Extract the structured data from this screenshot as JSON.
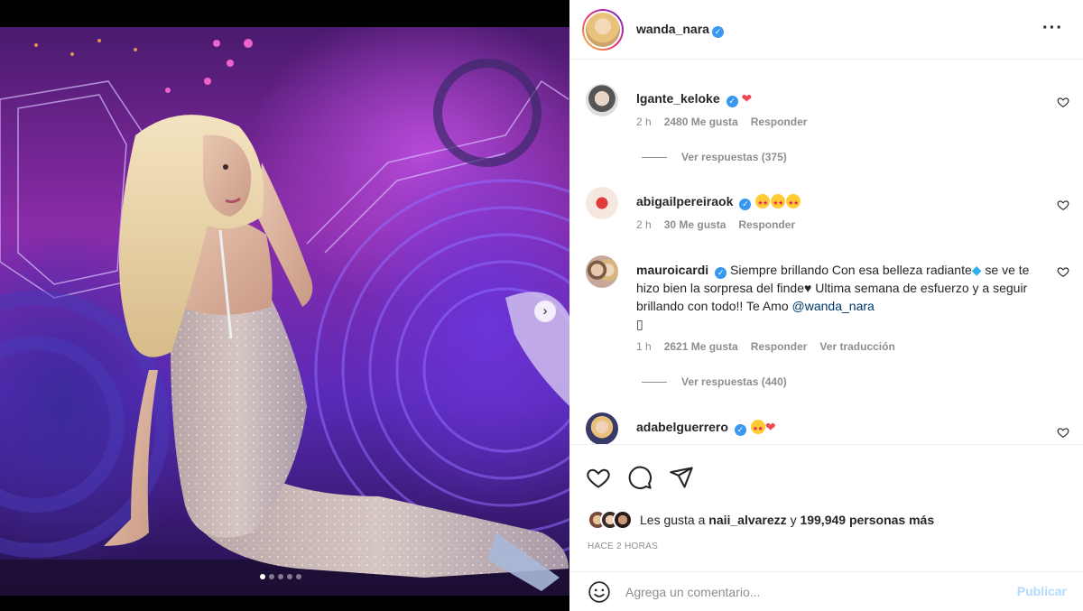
{
  "post": {
    "author": "wanda_nara",
    "more_icon": "more-options-icon",
    "carousel": {
      "slides": 5,
      "active": 1
    }
  },
  "comments": [
    {
      "user": "lgante_keloke",
      "verified": true,
      "text": "",
      "emoji": "heart",
      "time": "2 h",
      "likes": "2480 Me gusta",
      "reply": "Responder",
      "replies": "Ver respuestas (375)"
    },
    {
      "user": "abigailpereiraok",
      "verified": true,
      "text": "",
      "emoji": "star-struck x3",
      "time": "2 h",
      "likes": "30 Me gusta",
      "reply": "Responder"
    },
    {
      "user": "mauroicardi",
      "verified": true,
      "text": "Siempre brillando Con esa belleza radiante",
      "text2": "se ve te hizo bien la sorpresa del finde",
      "text3": "Ultima semana de esfuerzo y a seguir brillando con todo!! Te Amo",
      "mention": "@wanda_nara",
      "glyph": "▯",
      "time": "1 h",
      "likes": "2621 Me gusta",
      "reply": "Responder",
      "translate": "Ver traducción",
      "replies": "Ver respuestas (440)"
    },
    {
      "user": "adabelguerrero",
      "verified": true,
      "text": "",
      "emoji": "raising hands + heart"
    }
  ],
  "actions": {
    "likes_prefix": "Les gusta a",
    "liker": "naii_alvarezz",
    "likes_joiner": "y",
    "likes_rest": "199,949 personas más",
    "time": "HACE 2 HORAS"
  },
  "composer": {
    "placeholder": "Agrega un comentario...",
    "publish": "Publicar"
  },
  "colors": {
    "accent": "#3897f0",
    "like": "#ed4956",
    "muted": "#8e8e8e",
    "link": "#00376b"
  }
}
